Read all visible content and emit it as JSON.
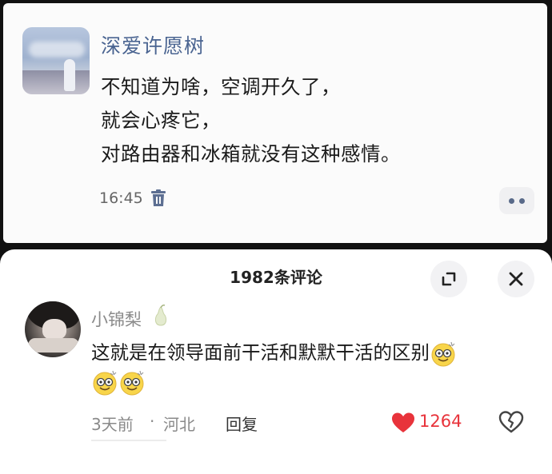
{
  "post": {
    "username": "深爱许愿树",
    "lines": [
      "不知道为啥，空调开久了，",
      "就会心疼它，",
      "对路由器和冰箱就没有这种感情。"
    ],
    "time": "16:45",
    "icons": {
      "delete": "trash-icon",
      "more": "more-icon"
    }
  },
  "comments_sheet": {
    "title": "1982条评论",
    "icons": {
      "expand": "expand-icon",
      "close": "close-icon"
    }
  },
  "comment": {
    "username": "小锦梨",
    "badge_icon": "pear-icon",
    "text_line1": "这就是在领导面前干活和默默干活的区别",
    "emoji_icon": "dizzy-smile-emoji",
    "time": "3天前",
    "separator": "·",
    "location": "河北",
    "reply_label": "回复",
    "like_count": "1264",
    "colors": {
      "like": "#e8333b",
      "username": "#8a8a8a",
      "post_username": "#4a6491"
    }
  }
}
